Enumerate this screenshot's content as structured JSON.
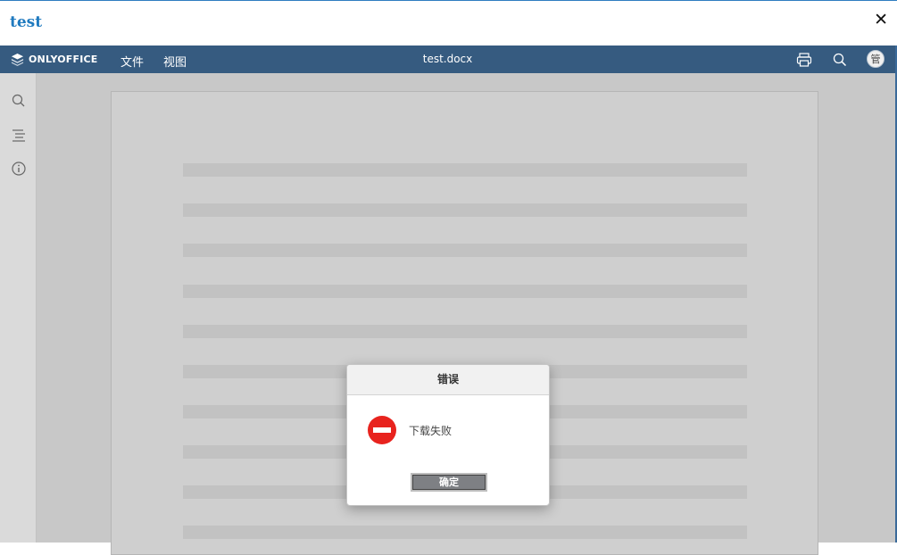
{
  "window": {
    "title": "test",
    "close_symbol": "✕"
  },
  "toolbar": {
    "logo_text": "ONLYOFFICE",
    "menu": [
      {
        "label": "文件"
      },
      {
        "label": "视图"
      }
    ],
    "document_title": "test.docx",
    "user_avatar": "管",
    "icons": [
      "print-icon",
      "search-icon"
    ]
  },
  "left_panel": {
    "icons": [
      "search-icon",
      "navigation-icon",
      "info-icon"
    ]
  },
  "dialog": {
    "title": "错误",
    "message": "下载失败",
    "ok_label": "确定",
    "icon": "error-icon"
  },
  "colors": {
    "toolbar": "#365b80",
    "title_accent": "#1f7abf",
    "error": "#e8231e",
    "button": "#7e8084"
  }
}
